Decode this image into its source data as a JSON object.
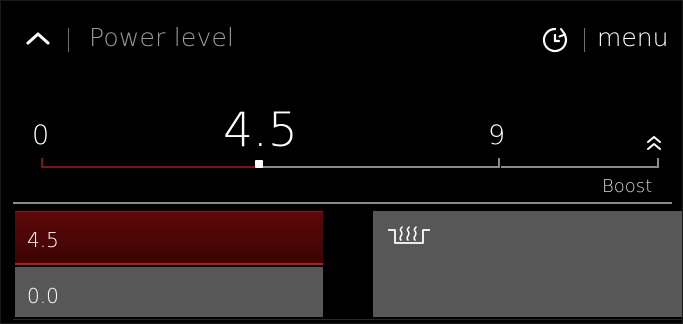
{
  "header": {
    "title": "Power level",
    "menu_label": "menu"
  },
  "slider": {
    "min_label": "0",
    "value_label": "4.5",
    "max_label": "9",
    "boost_label": "Boost",
    "min": 0,
    "max": 9,
    "value": 4.5
  },
  "zones": [
    {
      "value": "4.5",
      "selected": true
    },
    {
      "value": "0.0",
      "selected": false
    },
    {
      "icon": "keep-warm-icon",
      "selected": false
    }
  ],
  "icons": {
    "back": "chevron-up-icon",
    "timer": "timer-icon",
    "boost": "double-chevron-up-icon"
  },
  "colors": {
    "accent": "#c0151c",
    "active_zone": "#4a0606",
    "inactive_zone": "#575757",
    "track": "#8b8b8b",
    "background": "#000000"
  }
}
